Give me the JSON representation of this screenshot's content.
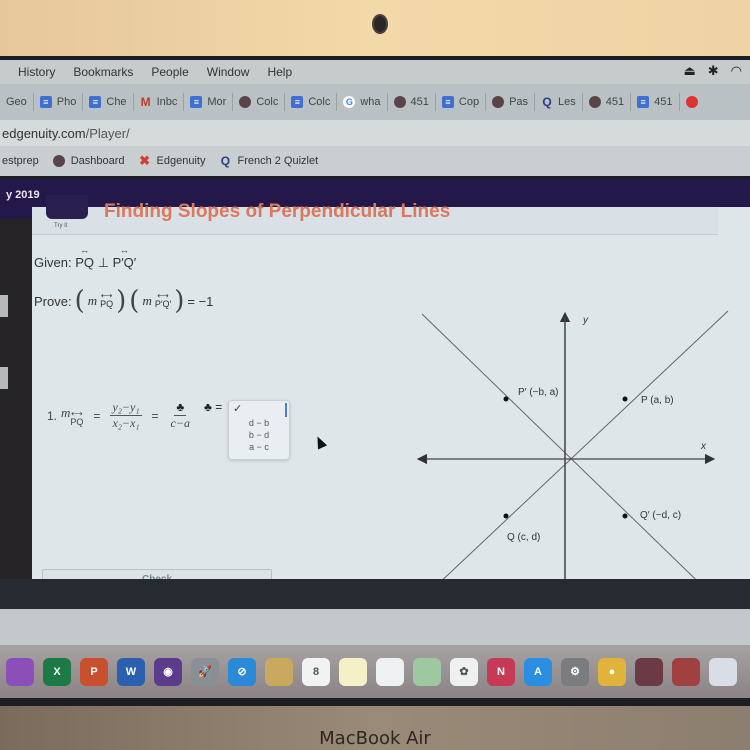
{
  "device": {
    "brand_label": "MacBook Air"
  },
  "menubar": {
    "items": [
      "History",
      "Bookmarks",
      "People",
      "Window",
      "Help"
    ],
    "status_icons": [
      "airplay-icon",
      "bluetooth-icon",
      "wifi-icon"
    ]
  },
  "tabs": [
    {
      "label": "Geo",
      "icon": "none"
    },
    {
      "label": "Pho",
      "icon": "docs-icon"
    },
    {
      "label": "Che",
      "icon": "docs-icon"
    },
    {
      "label": "Inbc",
      "icon": "gmail-icon"
    },
    {
      "label": "Mor",
      "icon": "docs-icon"
    },
    {
      "label": "Colc",
      "icon": "eagle-icon"
    },
    {
      "label": "Colc",
      "icon": "docs-icon"
    },
    {
      "label": "wha",
      "icon": "google-icon"
    },
    {
      "label": "451",
      "icon": "eagle-icon"
    },
    {
      "label": "Cop",
      "icon": "docs-icon"
    },
    {
      "label": "Pas",
      "icon": "eagle-icon"
    },
    {
      "label": "Les",
      "icon": "quizlet-icon"
    },
    {
      "label": "451",
      "icon": "eagle-icon"
    },
    {
      "label": "451",
      "icon": "docs-icon"
    }
  ],
  "address": {
    "domain": "edgenuity.com",
    "path": "/Player/"
  },
  "bookmarks": [
    {
      "label": "estprep",
      "icon": "none"
    },
    {
      "label": "Dashboard",
      "icon": "eagle-icon"
    },
    {
      "label": "Edgenuity",
      "icon": "edgenuity-icon"
    },
    {
      "label": "French 2 Quizlet",
      "icon": "quizlet-icon"
    }
  ],
  "course_bar": {
    "text": "y 2019"
  },
  "lesson": {
    "tryit_label": "Try It",
    "title": "Finding Slopes of Perpendicular Lines",
    "given_label": "Given:",
    "given_line1": "PQ",
    "perp_symbol": "⊥",
    "given_line2": "P′Q′",
    "prove_label": "Prove:",
    "prove_m": "m",
    "prove_sub1": "PQ",
    "prove_sub2": "P′Q′",
    "prove_rhs": "= −1",
    "step_number": "1.",
    "step_m": "m",
    "step_sub": "PQ",
    "equals": "=",
    "frac1_num": "y₂−y₁",
    "frac1_den": "x₂−x₁",
    "frac2_num": "♣",
    "frac2_den": "c−a",
    "club_prefix": "♣ =",
    "dropdown": {
      "selected": "✓",
      "options": [
        "d − b",
        "b − d",
        "a − c"
      ]
    },
    "check_button": "Check"
  },
  "graph": {
    "x_label": "x",
    "y_label": "y",
    "points": [
      {
        "name": "P",
        "label": "P (a, b)"
      },
      {
        "name": "P-prime",
        "label": "P′ (−b, a)"
      },
      {
        "name": "Q",
        "label": "Q (c, d)"
      },
      {
        "name": "Q-prime",
        "label": "Q′ (−d, c)"
      }
    ]
  },
  "dock": {
    "apps": [
      {
        "name": "onenote",
        "glyph": "",
        "color": "#8a4fb8"
      },
      {
        "name": "excel",
        "glyph": "X",
        "color": "#1e7a45"
      },
      {
        "name": "powerpoint",
        "glyph": "P",
        "color": "#c8502e"
      },
      {
        "name": "word",
        "glyph": "W",
        "color": "#2b5fb0"
      },
      {
        "name": "siri",
        "glyph": "◉",
        "color": "#5b3c8c"
      },
      {
        "name": "launchpad",
        "glyph": "🚀",
        "color": "#8a8f96"
      },
      {
        "name": "safari",
        "glyph": "⊘",
        "color": "#2a8ad8"
      },
      {
        "name": "finder-notes",
        "glyph": "",
        "color": "#c9a85f"
      },
      {
        "name": "calendar",
        "glyph": "8",
        "color": "#f2f2f2"
      },
      {
        "name": "notes",
        "glyph": "",
        "color": "#f5f0c8"
      },
      {
        "name": "reminders",
        "glyph": "",
        "color": "#eef1f2"
      },
      {
        "name": "maps",
        "glyph": "",
        "color": "#9dc8a0"
      },
      {
        "name": "photos",
        "glyph": "✿",
        "color": "#f0f0f0"
      },
      {
        "name": "news",
        "glyph": "N",
        "color": "#c63a55"
      },
      {
        "name": "app-store",
        "glyph": "A",
        "color": "#2b8ee0"
      },
      {
        "name": "system-preferences",
        "glyph": "⚙",
        "color": "#7a7d80"
      },
      {
        "name": "chrome",
        "glyph": "●",
        "color": "#e2b33a"
      },
      {
        "name": "eagle-app",
        "glyph": "",
        "color": "#6b3a44"
      },
      {
        "name": "photo-booth",
        "glyph": "",
        "color": "#a04040"
      },
      {
        "name": "preview",
        "glyph": "",
        "color": "#d8dee6"
      }
    ]
  }
}
